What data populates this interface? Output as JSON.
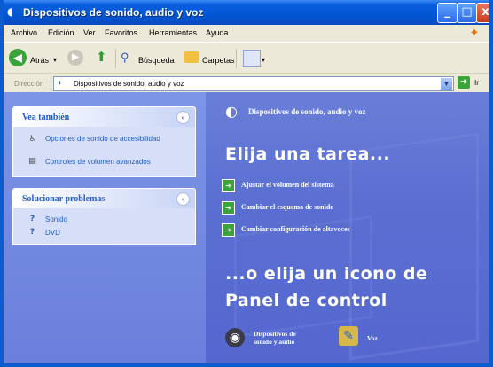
{
  "window": {
    "title": "Dispositivos de sonido, audio y voz",
    "buttons": {
      "minimize": "_",
      "maximize": "□",
      "close": "x"
    }
  },
  "menubar": {
    "items": [
      "Archivo",
      "Edición",
      "Ver",
      "Favoritos",
      "Herramientas",
      "Ayuda"
    ]
  },
  "toolbar": {
    "back": "Atrás",
    "back_arrow": "▾",
    "search": "Búsqueda",
    "folders": "Carpetas",
    "views_arrow": "▾"
  },
  "addressbar": {
    "label": "Dirección",
    "value": "Dispositivos de sonido, audio y voz",
    "go": "Ir"
  },
  "left_pane": {
    "see_also": {
      "title": "Vea también",
      "items": [
        "Opciones de sonido de accesibilidad",
        "Controles de volumen avanzados"
      ]
    },
    "troubleshoot": {
      "title": "Solucionar problemas",
      "items": [
        "Sonido",
        "DVD"
      ]
    }
  },
  "main": {
    "category_title": "Dispositivos de sonido, audio y voz",
    "pick_task": "Elija una tarea...",
    "tasks": [
      "Ajustar el volumen del sistema",
      "Cambiar el esquema de sonido",
      "Cambiar configuración de altavoces"
    ],
    "pick_icon_line1": "...o elija un icono de",
    "pick_icon_line2": "Panel de control",
    "icons": [
      {
        "line1": "Dispositivos de",
        "line2": "sonido y audio"
      },
      {
        "line1": "Voz",
        "line2": ""
      }
    ]
  },
  "colors": {
    "titlebar": "#0256d4",
    "content_bg": "#5b6fd2",
    "link": "#215dc6"
  },
  "icon_names": [
    "speaker-icon",
    "search-icon",
    "folder-icon",
    "views-icon",
    "go-arrow-icon",
    "speech-icon"
  ]
}
